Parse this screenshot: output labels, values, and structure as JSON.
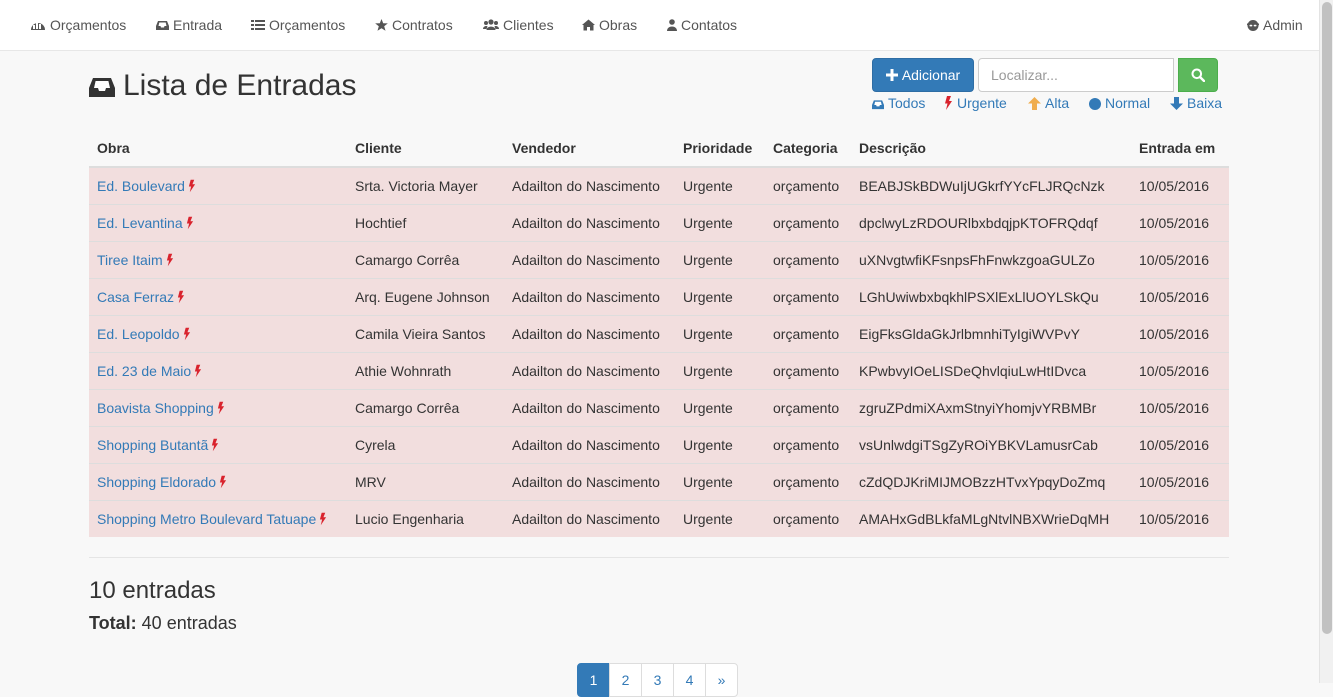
{
  "navbar": {
    "items": [
      {
        "label": "Orçamentos",
        "icon": "dashboard-icon"
      },
      {
        "label": "Entrada",
        "icon": "inbox-icon"
      },
      {
        "label": "Orçamentos",
        "icon": "list-icon"
      },
      {
        "label": "Contratos",
        "icon": "star-icon"
      },
      {
        "label": "Clientes",
        "icon": "users-icon"
      },
      {
        "label": "Obras",
        "icon": "home-icon"
      },
      {
        "label": "Contatos",
        "icon": "user-icon"
      }
    ],
    "admin": {
      "label": "Admin",
      "icon": "user-secret-icon"
    }
  },
  "page": {
    "title": "Lista de Entradas",
    "title_icon": "inbox-icon"
  },
  "toolbar": {
    "add_label": "Adicionar",
    "search_placeholder": "Localizar...",
    "search_icon": "search-icon"
  },
  "filters": [
    {
      "label": "Todos",
      "icon": "inbox-icon"
    },
    {
      "label": "Urgente",
      "icon": "bolt-icon"
    },
    {
      "label": "Alta",
      "icon": "arrow-up-icon"
    },
    {
      "label": "Normal",
      "icon": "circle-icon"
    },
    {
      "label": "Baixa",
      "icon": "arrow-down-icon"
    }
  ],
  "table": {
    "columns": [
      "Obra",
      "Cliente",
      "Vendedor",
      "Prioridade",
      "Categoria",
      "Descrição",
      "Entrada em"
    ],
    "rows": [
      {
        "obra": "Ed. Boulevard",
        "cliente": "Srta. Victoria Mayer",
        "vendedor": "Adailton do Nascimento",
        "prioridade": "Urgente",
        "categoria": "orçamento",
        "descricao": "BEABJSkBDWuIjUGkrfYYcFLJRQcNzk",
        "entrada": "10/05/2016"
      },
      {
        "obra": "Ed. Levantina",
        "cliente": "Hochtief",
        "vendedor": "Adailton do Nascimento",
        "prioridade": "Urgente",
        "categoria": "orçamento",
        "descricao": "dpclwyLzRDOURlbxbdqjpKTOFRQdqf",
        "entrada": "10/05/2016"
      },
      {
        "obra": "Tiree Itaim",
        "cliente": "Camargo Corrêa",
        "vendedor": "Adailton do Nascimento",
        "prioridade": "Urgente",
        "categoria": "orçamento",
        "descricao": "uXNvgtwfiKFsnpsFhFnwkzgoaGULZo",
        "entrada": "10/05/2016"
      },
      {
        "obra": "Casa Ferraz",
        "cliente": "Arq. Eugene Johnson",
        "vendedor": "Adailton do Nascimento",
        "prioridade": "Urgente",
        "categoria": "orçamento",
        "descricao": "LGhUwiwbxbqkhlPSXlExLlUOYLSkQu",
        "entrada": "10/05/2016"
      },
      {
        "obra": "Ed. Leopoldo",
        "cliente": "Camila Vieira Santos",
        "vendedor": "Adailton do Nascimento",
        "prioridade": "Urgente",
        "categoria": "orçamento",
        "descricao": "EigFksGldaGkJrlbmnhiTyIgiWVPvY",
        "entrada": "10/05/2016"
      },
      {
        "obra": "Ed. 23 de Maio",
        "cliente": "Athie Wohnrath",
        "vendedor": "Adailton do Nascimento",
        "prioridade": "Urgente",
        "categoria": "orçamento",
        "descricao": "KPwbvyIOeLISDeQhvlqiuLwHtIDvca",
        "entrada": "10/05/2016"
      },
      {
        "obra": "Boavista Shopping",
        "cliente": "Camargo Corrêa",
        "vendedor": "Adailton do Nascimento",
        "prioridade": "Urgente",
        "categoria": "orçamento",
        "descricao": "zgruZPdmiXAxmStnyiYhomjvYRBMBr",
        "entrada": "10/05/2016"
      },
      {
        "obra": "Shopping Butantã",
        "cliente": "Cyrela",
        "vendedor": "Adailton do Nascimento",
        "prioridade": "Urgente",
        "categoria": "orçamento",
        "descricao": "vsUnlwdgiTSgZyROiYBKVLamusrCab",
        "entrada": "10/05/2016"
      },
      {
        "obra": "Shopping Eldorado",
        "cliente": "MRV",
        "vendedor": "Adailton do Nascimento",
        "prioridade": "Urgente",
        "categoria": "orçamento",
        "descricao": "cZdQDJKriMIJMOBzzHTvxYpqyDoZmq",
        "entrada": "10/05/2016"
      },
      {
        "obra": "Shopping Metro Boulevard Tatuape",
        "cliente": "Lucio Engenharia",
        "vendedor": "Adailton do Nascimento",
        "prioridade": "Urgente",
        "categoria": "orçamento",
        "descricao": "AMAHxGdBLkfaMLgNtvlNBXWrieDqMH",
        "entrada": "10/05/2016"
      }
    ]
  },
  "summary": {
    "count": "10 entradas",
    "total_label": "Total:",
    "total_value": "40 entradas"
  },
  "pagination": {
    "pages": [
      "1",
      "2",
      "3",
      "4",
      "»"
    ],
    "active": "1"
  },
  "colors": {
    "link": "#337ab7",
    "urgent_row": "#f2dede",
    "bolt": "#d9232d",
    "alta": "#f0ad4e",
    "success": "#5cb85c"
  }
}
